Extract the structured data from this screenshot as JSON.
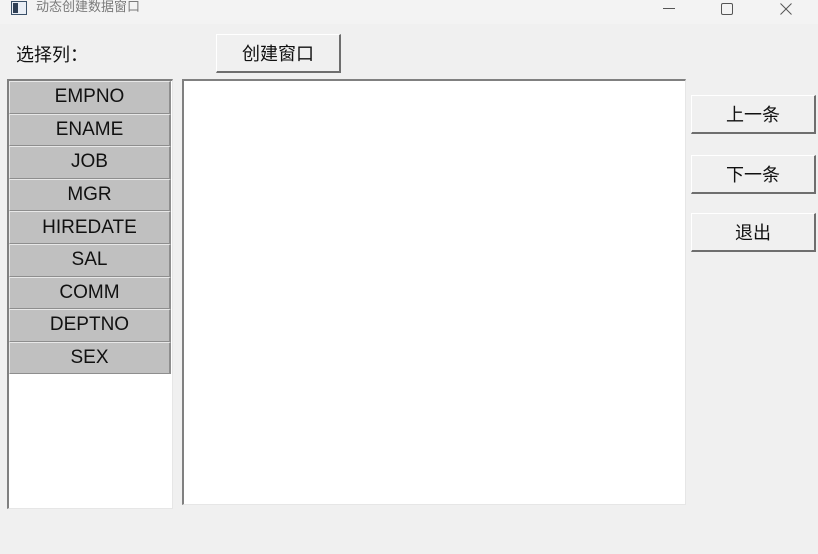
{
  "window": {
    "title": "动态创建数据窗口",
    "controls": {
      "minimize": "minimize-icon",
      "maximize": "maximize-icon",
      "close": "close-icon"
    }
  },
  "labels": {
    "select_columns": "选择列："
  },
  "buttons": {
    "create_window": "创建窗口",
    "previous": "上一条",
    "next": "下一条",
    "exit": "退出"
  },
  "columns": [
    "EMPNO",
    "ENAME",
    "JOB",
    "MGR",
    "HIREDATE",
    "SAL",
    "COMM",
    "DEPTNO",
    "SEX"
  ],
  "colors": {
    "list_item_bg": "#c0c0c0",
    "window_bg": "#f0f0f0",
    "panel_bg": "#ffffff"
  }
}
